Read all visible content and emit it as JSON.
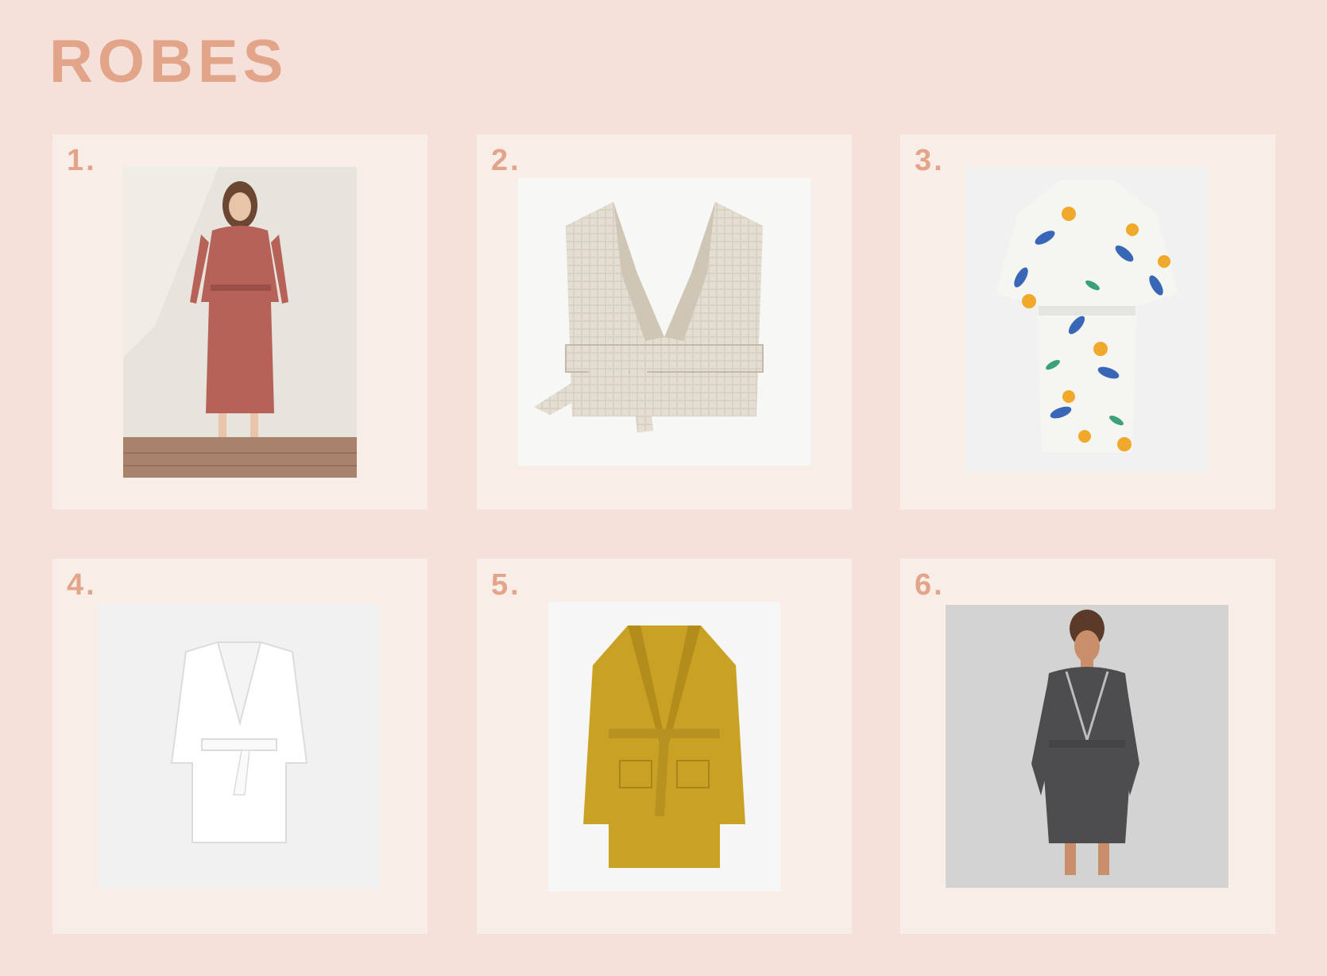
{
  "page": {
    "title": "ROBES",
    "background": "#f5e0da",
    "accent": "#e3a589",
    "card_background": "#f9ede8"
  },
  "products": [
    {
      "number": "1.",
      "image": "woman-in-rose-robe",
      "color": "#b66258"
    },
    {
      "number": "2.",
      "image": "beige-waffle-robe",
      "color": "#d9d1c3"
    },
    {
      "number": "3.",
      "image": "lemon-print-kimono-robe",
      "color": "#f2f2f2"
    },
    {
      "number": "4.",
      "image": "white-robe",
      "color": "#ffffff"
    },
    {
      "number": "5.",
      "image": "mustard-robe",
      "color": "#c9a125"
    },
    {
      "number": "6.",
      "image": "woman-in-gray-robe",
      "color": "#4d4d4f"
    }
  ]
}
